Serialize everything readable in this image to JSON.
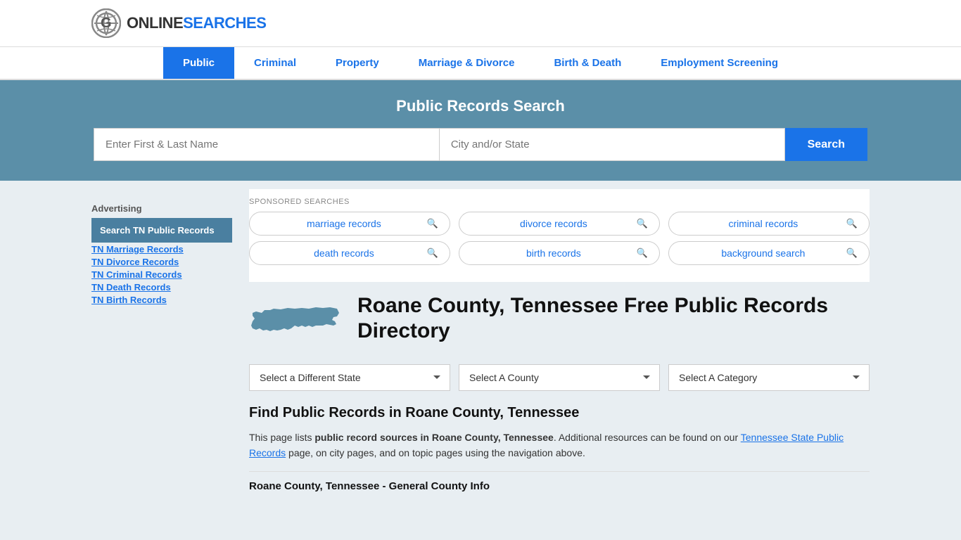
{
  "site": {
    "logo_text_online": "ONLINE",
    "logo_text_searches": "SEARCHES"
  },
  "nav": {
    "items": [
      {
        "label": "Public",
        "active": true
      },
      {
        "label": "Criminal",
        "active": false
      },
      {
        "label": "Property",
        "active": false
      },
      {
        "label": "Marriage & Divorce",
        "active": false
      },
      {
        "label": "Birth & Death",
        "active": false
      },
      {
        "label": "Employment Screening",
        "active": false
      }
    ]
  },
  "search_banner": {
    "title": "Public Records Search",
    "name_placeholder": "Enter First & Last Name",
    "location_placeholder": "City and/or State",
    "button_label": "Search"
  },
  "sponsored": {
    "label": "SPONSORED SEARCHES",
    "pills": [
      {
        "text": "marriage records"
      },
      {
        "text": "divorce records"
      },
      {
        "text": "criminal records"
      },
      {
        "text": "death records"
      },
      {
        "text": "birth records"
      },
      {
        "text": "background search"
      }
    ]
  },
  "county": {
    "title": "Roane County, Tennessee Free Public Records Directory"
  },
  "dropdowns": {
    "state_label": "Select a Different State",
    "county_label": "Select A County",
    "category_label": "Select A Category"
  },
  "find_section": {
    "heading": "Find Public Records in Roane County, Tennessee",
    "paragraph_part1": "This page lists ",
    "bold_text": "public record sources in Roane County, Tennessee",
    "paragraph_part2": ". Additional resources can be found on our ",
    "link_text": "Tennessee State Public Records",
    "paragraph_part3": " page, on city pages, and on topic pages using the navigation above."
  },
  "general_info": {
    "title": "Roane County, Tennessee - General County Info"
  },
  "sidebar": {
    "advertising_label": "Advertising",
    "ad_block_text": "Search TN Public Records",
    "links": [
      {
        "text": "TN Marriage Records"
      },
      {
        "text": "TN Divorce Records"
      },
      {
        "text": "TN Criminal Records"
      },
      {
        "text": "TN Death Records"
      },
      {
        "text": "TN Birth Records"
      }
    ]
  }
}
